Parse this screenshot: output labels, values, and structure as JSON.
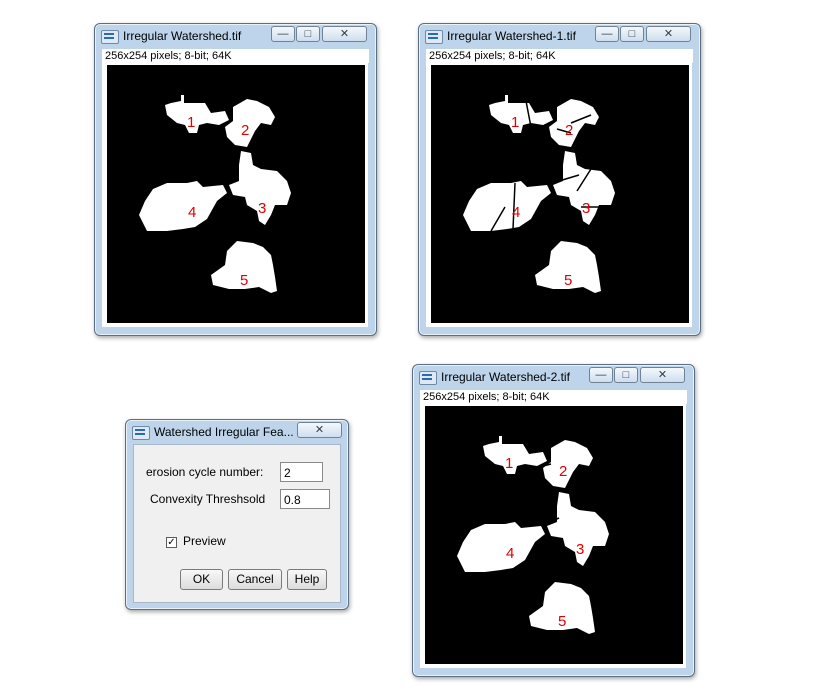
{
  "windows": [
    {
      "title": "Irregular Watershed.tif",
      "info": "256x254 pixels; 8-bit; 64K",
      "labels": [
        "1",
        "2",
        "3",
        "4",
        "5"
      ]
    },
    {
      "title": "Irregular Watershed-1.tif",
      "info": "256x254 pixels; 8-bit; 64K",
      "labels": [
        "1",
        "2",
        "3",
        "4",
        "5"
      ]
    },
    {
      "title": "Irregular Watershed-2.tif",
      "info": "256x254 pixels; 8-bit; 64K",
      "labels": [
        "1",
        "2",
        "3",
        "4",
        "5"
      ]
    }
  ],
  "dialog": {
    "title": "Watershed Irregular Fea...",
    "erosion_label": "erosion cycle number:",
    "erosion_value": "2",
    "convexity_label": "Convexity Threshsold",
    "convexity_value": "0.8",
    "preview_label": "Preview",
    "preview_checked": true,
    "ok_label": "OK",
    "cancel_label": "Cancel",
    "help_label": "Help"
  },
  "controls": {
    "minimize_glyph": "—",
    "maximize_glyph": "□",
    "close_glyph": "✕",
    "check_glyph": "✓"
  }
}
